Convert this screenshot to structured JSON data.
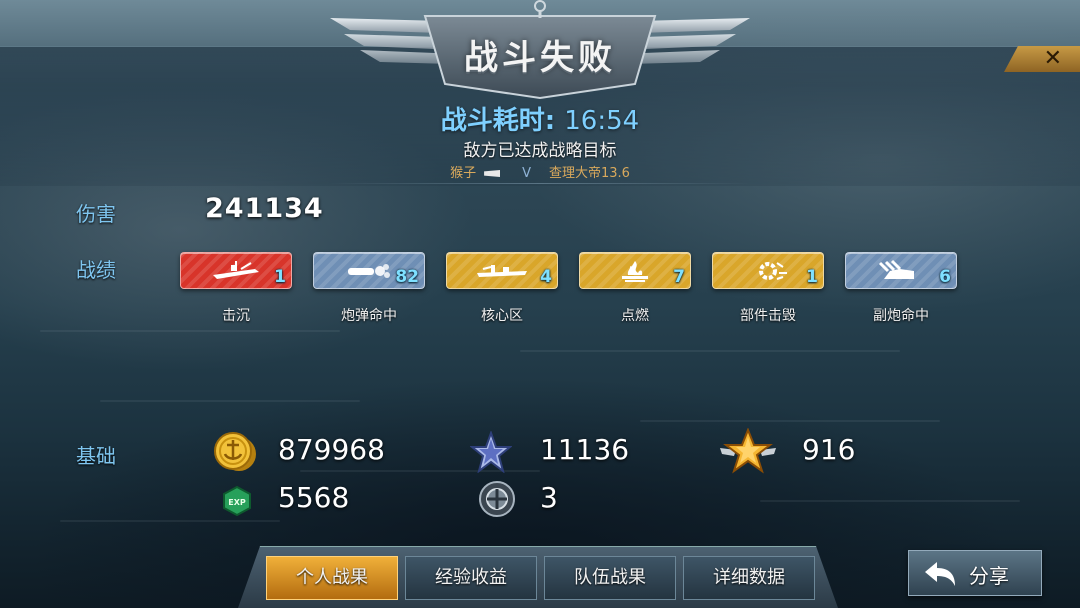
{
  "header": {
    "title": "战斗失败",
    "duration_label": "战斗耗时:",
    "duration_value": "16:54",
    "reason": "敌方已达成战略目标",
    "kill_feed": {
      "killer": "猴子",
      "separator": "V",
      "victim": "查理大帝13.6"
    }
  },
  "stats": {
    "damage_label": "伤害",
    "damage_value": "241134",
    "record_label": "战绩",
    "badges": [
      {
        "label": "击沉",
        "count": "1",
        "color": "red",
        "icon": "ship-sink-icon"
      },
      {
        "label": "炮弹命中",
        "count": "82",
        "color": "blue",
        "icon": "shell-hit-icon"
      },
      {
        "label": "核心区",
        "count": "4",
        "color": "gold",
        "icon": "citadel-icon"
      },
      {
        "label": "点燃",
        "count": "7",
        "color": "gold",
        "icon": "fire-icon"
      },
      {
        "label": "部件击毁",
        "count": "1",
        "color": "gold",
        "icon": "module-destroy-icon"
      },
      {
        "label": "副炮命中",
        "count": "6",
        "color": "blue",
        "icon": "secondary-gun-icon"
      }
    ],
    "base_label": "基础",
    "resources": {
      "coins": "879968",
      "free_xp": "11136",
      "elite_star": "916",
      "exp": "5568",
      "token": "3"
    }
  },
  "tabs": [
    {
      "label": "个人战果",
      "active": true
    },
    {
      "label": "经验收益",
      "active": false
    },
    {
      "label": "队伍战果",
      "active": false
    },
    {
      "label": "详细数据",
      "active": false
    }
  ],
  "share": {
    "label": "分享"
  },
  "colors": {
    "accent_blue": "#7fc6f0",
    "active_tab": "#e39a25",
    "badge_red": "#d8342a",
    "badge_gold": "#d9a62a",
    "badge_blue": "#6f8fb5"
  }
}
